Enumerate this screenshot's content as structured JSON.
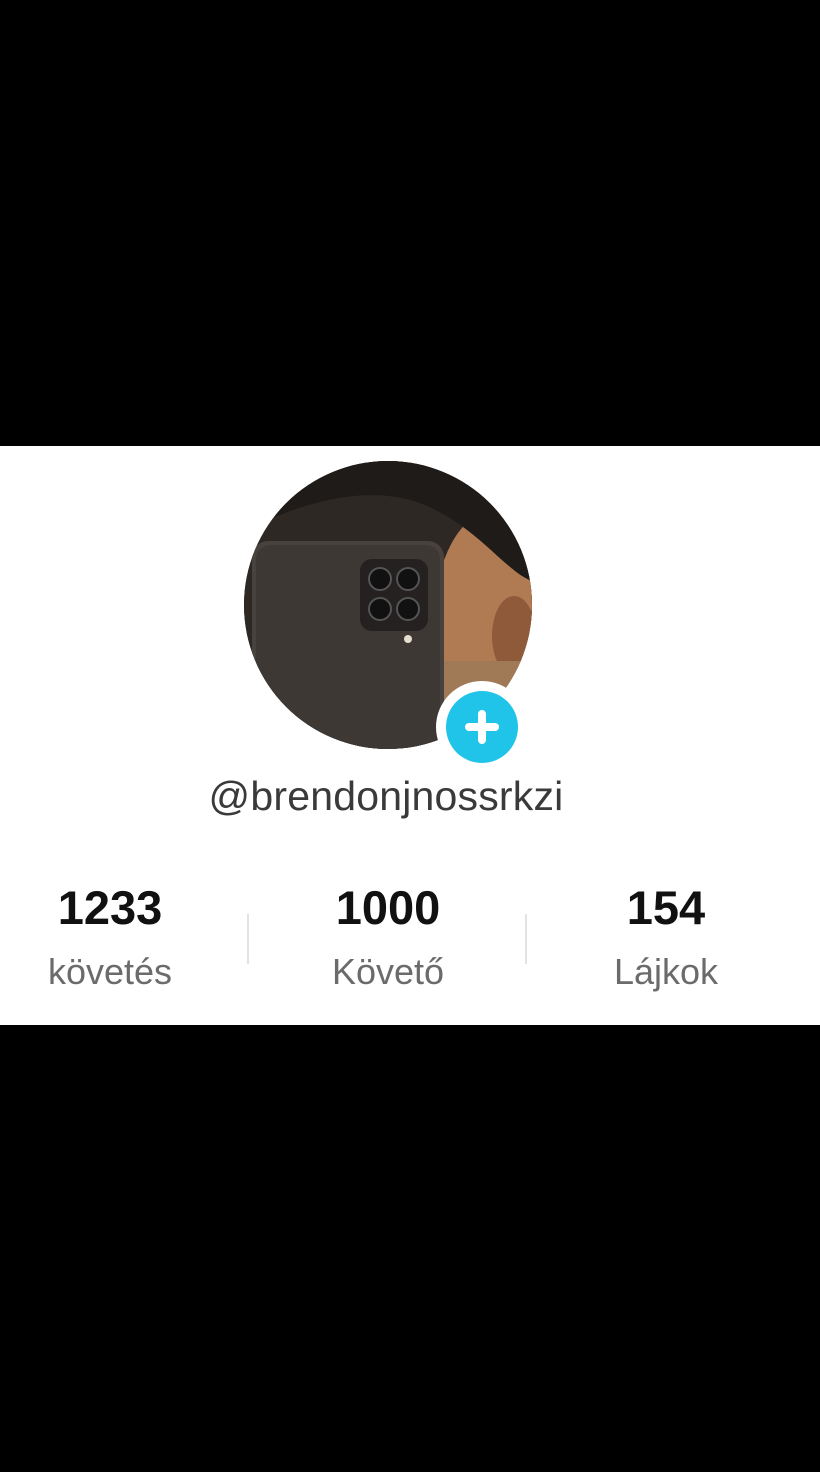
{
  "profile": {
    "username": "@brendonjnossrkzi",
    "avatar_icon": "profile-photo",
    "add_icon": "plus-icon",
    "add_color": "#20c4e8"
  },
  "stats": [
    {
      "value": "1233",
      "label": "követés"
    },
    {
      "value": "1000",
      "label": "Követő"
    },
    {
      "value": "154",
      "label": "Lájkok"
    }
  ]
}
